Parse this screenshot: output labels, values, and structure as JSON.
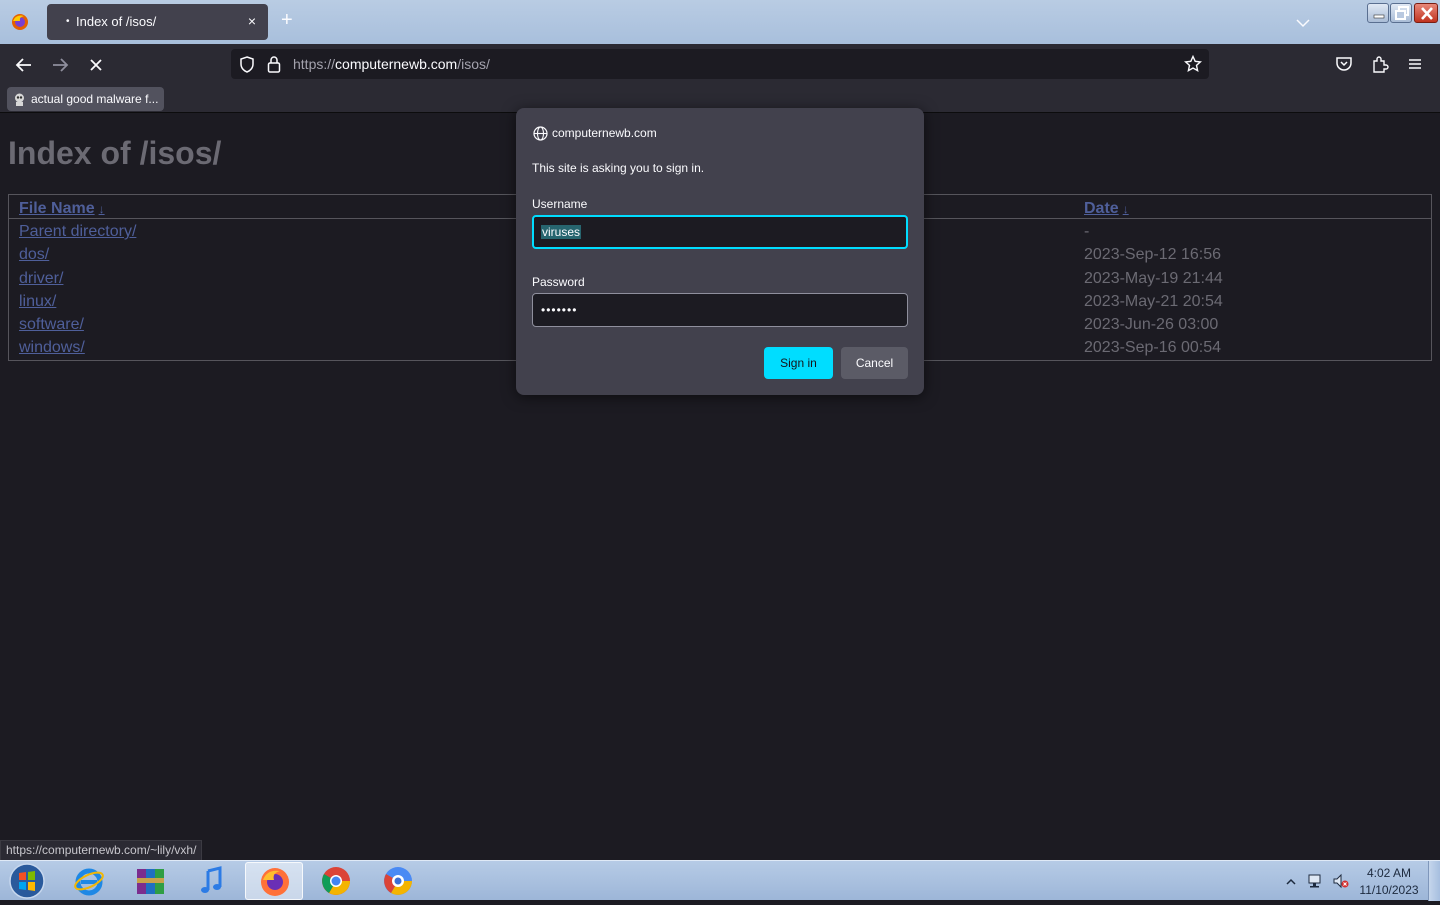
{
  "browser": {
    "tab": {
      "title": "Index of /isos/",
      "close_glyph": "×",
      "loading_dot": "•"
    },
    "new_tab_glyph": "+",
    "url": {
      "scheme": "https://",
      "host": "computernewb.com",
      "path": "/isos/"
    },
    "bookmark": {
      "label": "actual good malware f..."
    },
    "status_link": "https://computernewb.com/~lily/vxh/",
    "icons": [
      "firefox-icon",
      "tab-list-chevron-icon",
      "back-arrow-icon",
      "forward-arrow-icon",
      "stop-icon",
      "shield-icon",
      "lock-icon",
      "star-icon",
      "pocket-icon",
      "extensions-icon",
      "hamburger-menu-icon"
    ]
  },
  "page": {
    "title": "Index of /isos/",
    "columns": {
      "name": "File Name",
      "date": "Date",
      "sort_glyph": "↓"
    },
    "rows": [
      {
        "name": "Parent directory/",
        "date": "-"
      },
      {
        "name": "dos/",
        "date": "2023-Sep-12 16:56"
      },
      {
        "name": "driver/",
        "date": "2023-May-19 21:44"
      },
      {
        "name": "linux/",
        "date": "2023-May-21 20:54"
      },
      {
        "name": "software/",
        "date": "2023-Jun-26 03:00"
      },
      {
        "name": "windows/",
        "date": "2023-Sep-16 00:54"
      }
    ]
  },
  "dialog": {
    "host": "computernewb.com",
    "message": "This site is asking you to sign in.",
    "username_label": "Username",
    "username_value": "viruses",
    "password_label": "Password",
    "password_value": "•••••••",
    "sign_in_label": "Sign in",
    "cancel_label": "Cancel",
    "accent_color": "#00ddff"
  },
  "taskbar": {
    "apps": [
      "start-orb",
      "internet-explorer-icon",
      "winrar-icon",
      "itunes-icon",
      "firefox-icon",
      "chrome-icon",
      "chromium-icon"
    ],
    "clock": {
      "time": "4:02 AM",
      "date": "11/10/2023"
    }
  }
}
